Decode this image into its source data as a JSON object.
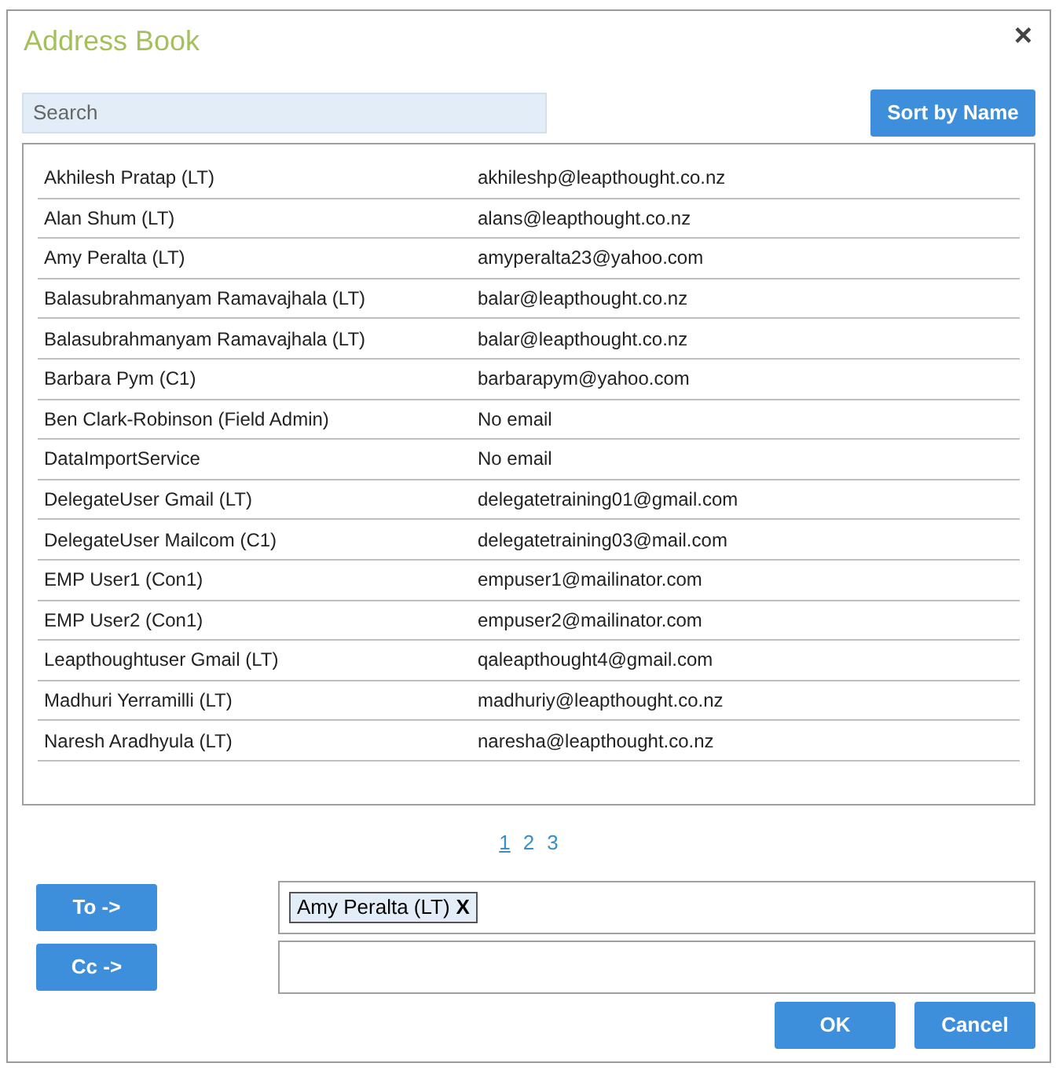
{
  "window": {
    "title": "Address Book",
    "close": "×"
  },
  "search": {
    "placeholder": "Search"
  },
  "sort_button": "Sort by Name",
  "contacts": [
    {
      "name": "Akhilesh Pratap (LT)",
      "email": "akhileshp@leapthought.co.nz"
    },
    {
      "name": "Alan Shum (LT)",
      "email": "alans@leapthought.co.nz"
    },
    {
      "name": "Amy Peralta (LT)",
      "email": "amyperalta23@yahoo.com"
    },
    {
      "name": "Balasubrahmanyam Ramavajhala (LT)",
      "email": "balar@leapthought.co.nz"
    },
    {
      "name": "Balasubrahmanyam Ramavajhala (LT)",
      "email": "balar@leapthought.co.nz"
    },
    {
      "name": "Barbara Pym (C1)",
      "email": "barbarapym@yahoo.com"
    },
    {
      "name": "Ben Clark-Robinson (Field Admin)",
      "email": "No email"
    },
    {
      "name": "DataImportService",
      "email": "No email"
    },
    {
      "name": "DelegateUser Gmail (LT)",
      "email": "delegatetraining01@gmail.com"
    },
    {
      "name": "DelegateUser Mailcom (C1)",
      "email": "delegatetraining03@mail.com"
    },
    {
      "name": "EMP User1 (Con1)",
      "email": "empuser1@mailinator.com"
    },
    {
      "name": "EMP User2 (Con1)",
      "email": "empuser2@mailinator.com"
    },
    {
      "name": "Leapthoughtuser Gmail (LT)",
      "email": "qaleapthought4@gmail.com"
    },
    {
      "name": "Madhuri Yerramilli (LT)",
      "email": "madhuriy@leapthought.co.nz"
    },
    {
      "name": "Naresh Aradhyula (LT)",
      "email": "naresha@leapthought.co.nz"
    }
  ],
  "pages": [
    {
      "label": "1",
      "selected": true
    },
    {
      "label": "2",
      "selected": false
    },
    {
      "label": "3",
      "selected": false
    }
  ],
  "recipients": [
    {
      "button": "To ->",
      "chips": [
        {
          "label": "Amy Peralta (LT)",
          "remove": "X"
        }
      ]
    },
    {
      "button": "Cc ->"
    }
  ],
  "actions": [
    "OK",
    "Cancel"
  ]
}
